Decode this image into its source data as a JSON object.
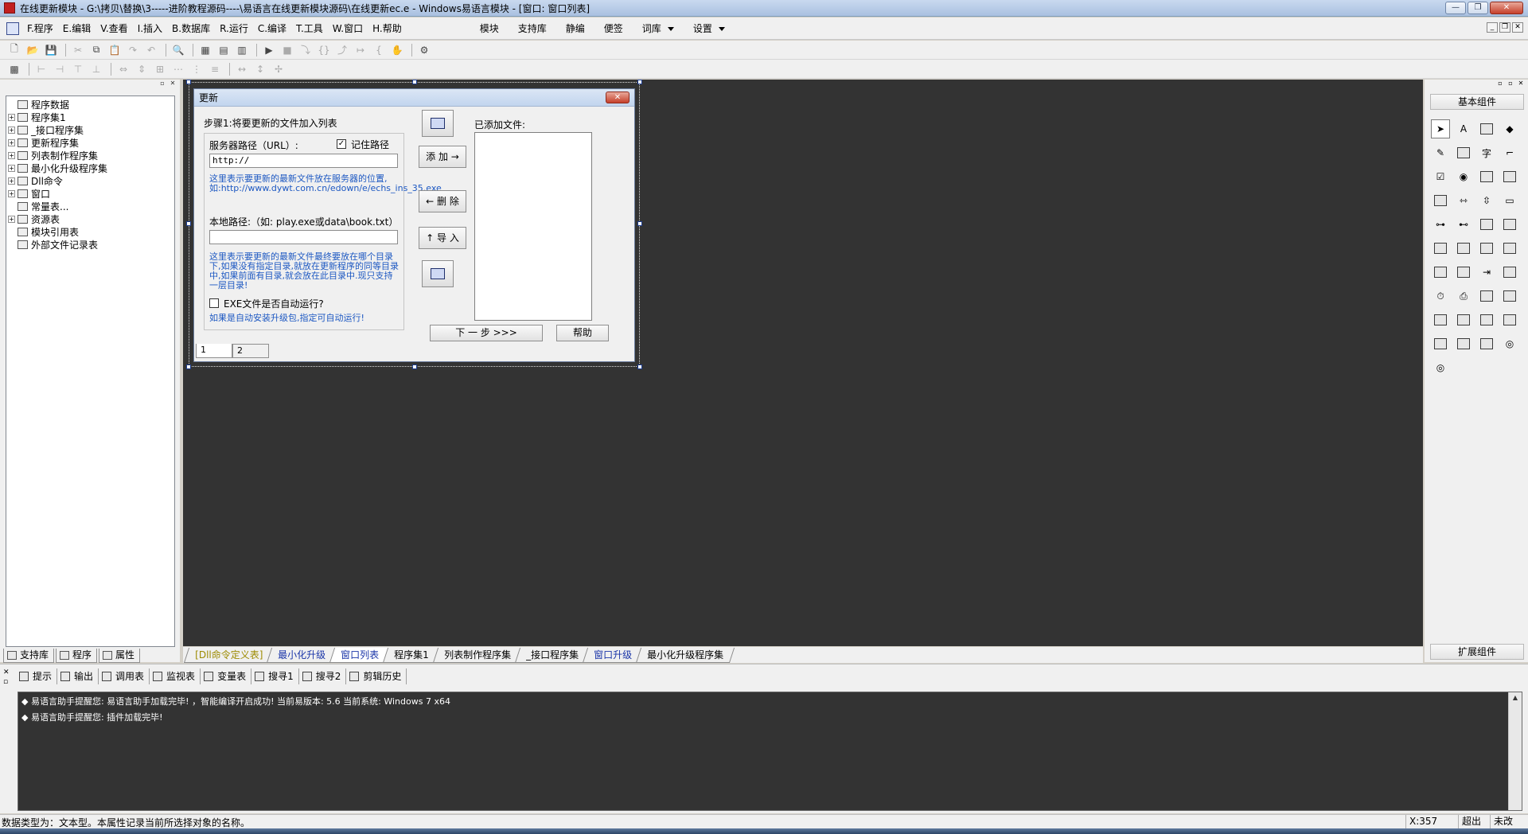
{
  "titlebar": {
    "title": "在线更新模块 - G:\\拷贝\\替换\\3-----进阶教程源码----\\易语言在线更新模块源码\\在线更新ec.e - Windows易语言模块 - [窗口: 窗口列表]",
    "min": "—",
    "restore": "❐",
    "close": "✕"
  },
  "menubar": {
    "items": [
      "F.程序",
      "E.编辑",
      "V.查看",
      "I.插入",
      "B.数据库",
      "R.运行",
      "C.编译",
      "T.工具",
      "W.窗口",
      "H.帮助"
    ],
    "items2": [
      "模块",
      "支持库",
      "静编",
      "便签",
      "词库",
      "设置"
    ],
    "mdi": [
      "_",
      "❐",
      "✕"
    ]
  },
  "leftpanel": {
    "tree": [
      {
        "label": "程序数据",
        "level": 0,
        "pm": ""
      },
      {
        "label": "程序集1",
        "level": 1,
        "pm": "+"
      },
      {
        "label": "_接口程序集",
        "level": 1,
        "pm": "+"
      },
      {
        "label": "更新程序集",
        "level": 1,
        "pm": "+"
      },
      {
        "label": "列表制作程序集",
        "level": 1,
        "pm": "+"
      },
      {
        "label": "最小化升级程序集",
        "level": 1,
        "pm": "+"
      },
      {
        "label": "Dll命令",
        "level": 1,
        "pm": "+"
      },
      {
        "label": "窗口",
        "level": 1,
        "pm": "+"
      },
      {
        "label": "常量表...",
        "level": 1,
        "pm": ""
      },
      {
        "label": "资源表",
        "level": 1,
        "pm": "+"
      },
      {
        "label": "模块引用表",
        "level": 1,
        "pm": ""
      },
      {
        "label": "外部文件记录表",
        "level": 1,
        "pm": ""
      }
    ],
    "tabs": [
      "支持库",
      "程序",
      "属性"
    ]
  },
  "designer": {
    "window_title": "更新",
    "close": "✕",
    "step_label": "步骤1:将要更新的文件加入列表",
    "server_path_label": "服务器路径（URL）:",
    "remember_path_label": "记住路径",
    "remember_checked": "✓",
    "url_value": "http://",
    "hint1": "这里表示要更新的最新文件放在服务器的位置,如:http://www.dywt.com.cn/edown/e/echs_ins_35.exe",
    "local_path_label": "本地路径:（如: play.exe或data\\book.txt）",
    "local_value": "",
    "hint2": "这里表示要更新的最新文件最终要放在哪个目录下,如果没有指定目录,就放在更新程序的同等目录中,如果前面有目录,就会放在此目录中.现只支持一层目录!",
    "exe_auto_label": "EXE文件是否自动运行?",
    "hint3": "如果是自动安装升级包,指定可自动运行!",
    "added_files_label": "已添加文件:",
    "add_btn": "添 加 →",
    "delete_btn": "← 删 除",
    "import_btn": "↑ 导 入",
    "next_btn": "下 一 步 >>>",
    "help_btn": "帮助",
    "tabs": [
      "1",
      "2"
    ]
  },
  "editor_tabs": [
    {
      "label": "[Dll命令定义表]",
      "style": "yellow"
    },
    {
      "label": "最小化升级",
      "style": "blue"
    },
    {
      "label": "窗口列表",
      "style": "blue-active"
    },
    {
      "label": "程序集1",
      "style": "normal"
    },
    {
      "label": "列表制作程序集",
      "style": "normal"
    },
    {
      "label": "_接口程序集",
      "style": "normal"
    },
    {
      "label": "窗口升级",
      "style": "blue"
    },
    {
      "label": "最小化升级程序集",
      "style": "normal"
    }
  ],
  "rightpanel": {
    "basic": "基本组件",
    "ext": "扩展组件"
  },
  "output": {
    "tabs": [
      "提示",
      "输出",
      "调用表",
      "监视表",
      "变量表",
      "搜寻1",
      "搜寻2",
      "剪辑历史"
    ],
    "lines": [
      "◆ 易语言助手提醒您: 易语言助手加载完毕! ，智能编译开启成功! 当前易版本: 5.6  当前系统: Windows 7 x64",
      "◆ 易语言助手提醒您: 插件加载完毕!"
    ]
  },
  "status": {
    "text": "数据类型为：文本型。本属性记录当前所选择对象的名称。",
    "coord": "X:357",
    "mode1": "超出",
    "mode2": "未改"
  }
}
